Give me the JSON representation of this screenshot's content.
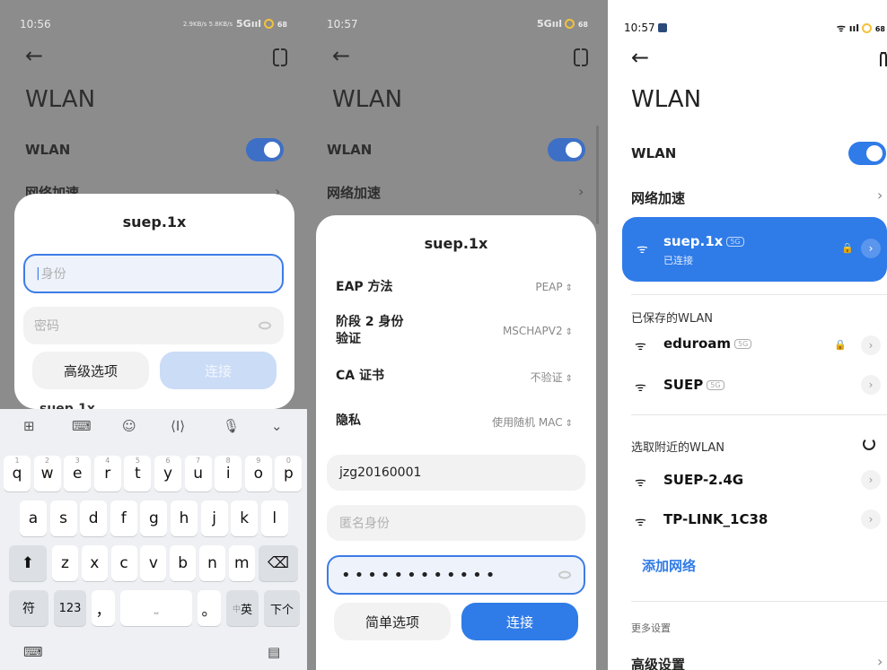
{
  "panel1": {
    "status": {
      "time": "10:56",
      "network": "5G",
      "speed": "2.9KB/s 5.8KB/s",
      "battery": "68"
    },
    "title": "WLAN",
    "wlan_label": "WLAN",
    "net_accel_label": "网络加速",
    "dialog": {
      "title": "suep.1x",
      "identity_placeholder": "身份",
      "password_placeholder": "密码",
      "advanced_button": "高级选项",
      "connect_button": "连接"
    },
    "behind_row": "suep.1x",
    "keyboard": {
      "row1": [
        "q",
        "w",
        "e",
        "r",
        "t",
        "y",
        "u",
        "i",
        "o",
        "p"
      ],
      "row1_nums": [
        "1",
        "2",
        "3",
        "4",
        "5",
        "6",
        "7",
        "8",
        "9",
        "0"
      ],
      "row2": [
        "a",
        "s",
        "d",
        "f",
        "g",
        "h",
        "j",
        "k",
        "l"
      ],
      "row3": [
        "z",
        "x",
        "c",
        "v",
        "b",
        "n",
        "m"
      ],
      "symbols": "符",
      "numbers": "123",
      "comma": "，",
      "period": "。",
      "lang_cn": "中",
      "lang_en": "英",
      "next": "下个"
    }
  },
  "panel2": {
    "status": {
      "time": "10:57",
      "network": "5G",
      "battery": "68"
    },
    "title": "WLAN",
    "wlan_label": "WLAN",
    "net_accel_label": "网络加速",
    "dialog": {
      "title": "suep.1x",
      "eap_label": "EAP 方法",
      "eap_value": "PEAP",
      "phase2_label_l1": "阶段 2 身份",
      "phase2_label_l2": "验证",
      "phase2_value": "MSCHAPV2",
      "ca_label": "CA 证书",
      "ca_value": "不验证",
      "privacy_label": "隐私",
      "privacy_value": "使用随机 MAC",
      "identity_value": "jzg20160001",
      "anon_placeholder": "匿名身份",
      "password_mask": "••••••••••••",
      "simple_button": "简单选项",
      "connect_button": "连接"
    }
  },
  "panel3": {
    "status": {
      "time": "10:57",
      "battery": "68"
    },
    "title": "WLAN",
    "wlan_label": "WLAN",
    "net_accel_label": "网络加速",
    "connected": {
      "name": "suep.1x",
      "band": "5G",
      "status": "已连接"
    },
    "saved_header": "已保存的WLAN",
    "saved": [
      {
        "name": "eduroam",
        "band": "5G"
      },
      {
        "name": "SUEP",
        "band": "5G"
      }
    ],
    "nearby_header": "选取附近的WLAN",
    "nearby": [
      {
        "name": "SUEP-2.4G"
      },
      {
        "name": "TP-LINK_1C38"
      }
    ],
    "add_network": "添加网络",
    "more_header": "更多设置",
    "advanced": "高级设置"
  },
  "colors": {
    "accent": "#2f7be8",
    "toggle": "#3d7ce6"
  }
}
